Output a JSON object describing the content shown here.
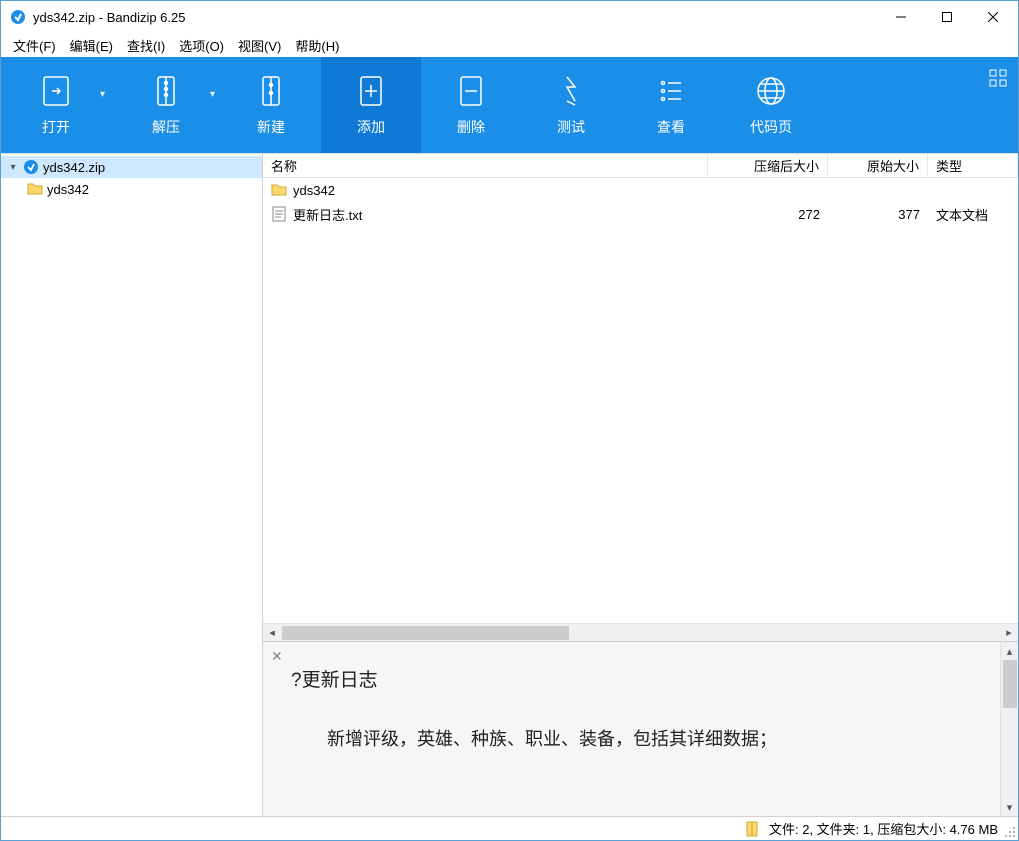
{
  "title": "yds342.zip - Bandizip 6.25",
  "menu": {
    "file": "文件(F)",
    "edit": "编辑(E)",
    "find": "查找(I)",
    "options": "选项(O)",
    "view": "视图(V)",
    "help": "帮助(H)"
  },
  "toolbar": {
    "open": "打开",
    "extract": "解压",
    "new": "新建",
    "add": "添加",
    "delete": "删除",
    "test": "测试",
    "view": "查看",
    "codepage": "代码页"
  },
  "tree": {
    "root": "yds342.zip",
    "child": "yds342"
  },
  "columns": {
    "name": "名称",
    "packed": "压缩后大小",
    "orig": "原始大小",
    "type": "类型"
  },
  "files": [
    {
      "name": "yds342",
      "packed": "",
      "orig": "",
      "type": "",
      "kind": "folder"
    },
    {
      "name": "更新日志.txt",
      "packed": "272",
      "orig": "377",
      "type": "文本文档",
      "kind": "text"
    }
  ],
  "preview": {
    "heading": "?更新日志",
    "line1": "新增评级，英雄、种族、职业、装备，包括其详细数据；"
  },
  "status": "文件: 2, 文件夹: 1, 压缩包大小: 4.76 MB"
}
